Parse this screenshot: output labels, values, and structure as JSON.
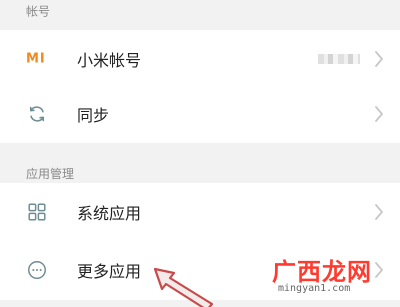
{
  "sections": {
    "account_header": "帐号",
    "app_management_header": "应用管理"
  },
  "rows": {
    "xiaomi_account": {
      "icon_text": "MI",
      "label": "小米帐号"
    },
    "sync": {
      "label": "同步"
    },
    "system_apps": {
      "label": "系统应用"
    },
    "more_apps": {
      "label": "更多应用"
    }
  },
  "watermark": {
    "main": "广西龙网",
    "sub": "mingyan1.com"
  },
  "colors": {
    "accent": "#f08a20",
    "icon_gray": "#6d8c93",
    "watermark_red": "#ff3b30",
    "arrow_red": "#c84a4a"
  },
  "icons": {
    "sync": "sync-icon",
    "system_apps": "grid-icon",
    "more_apps": "more-dots-icon",
    "chevron": "chevron-right-icon"
  }
}
